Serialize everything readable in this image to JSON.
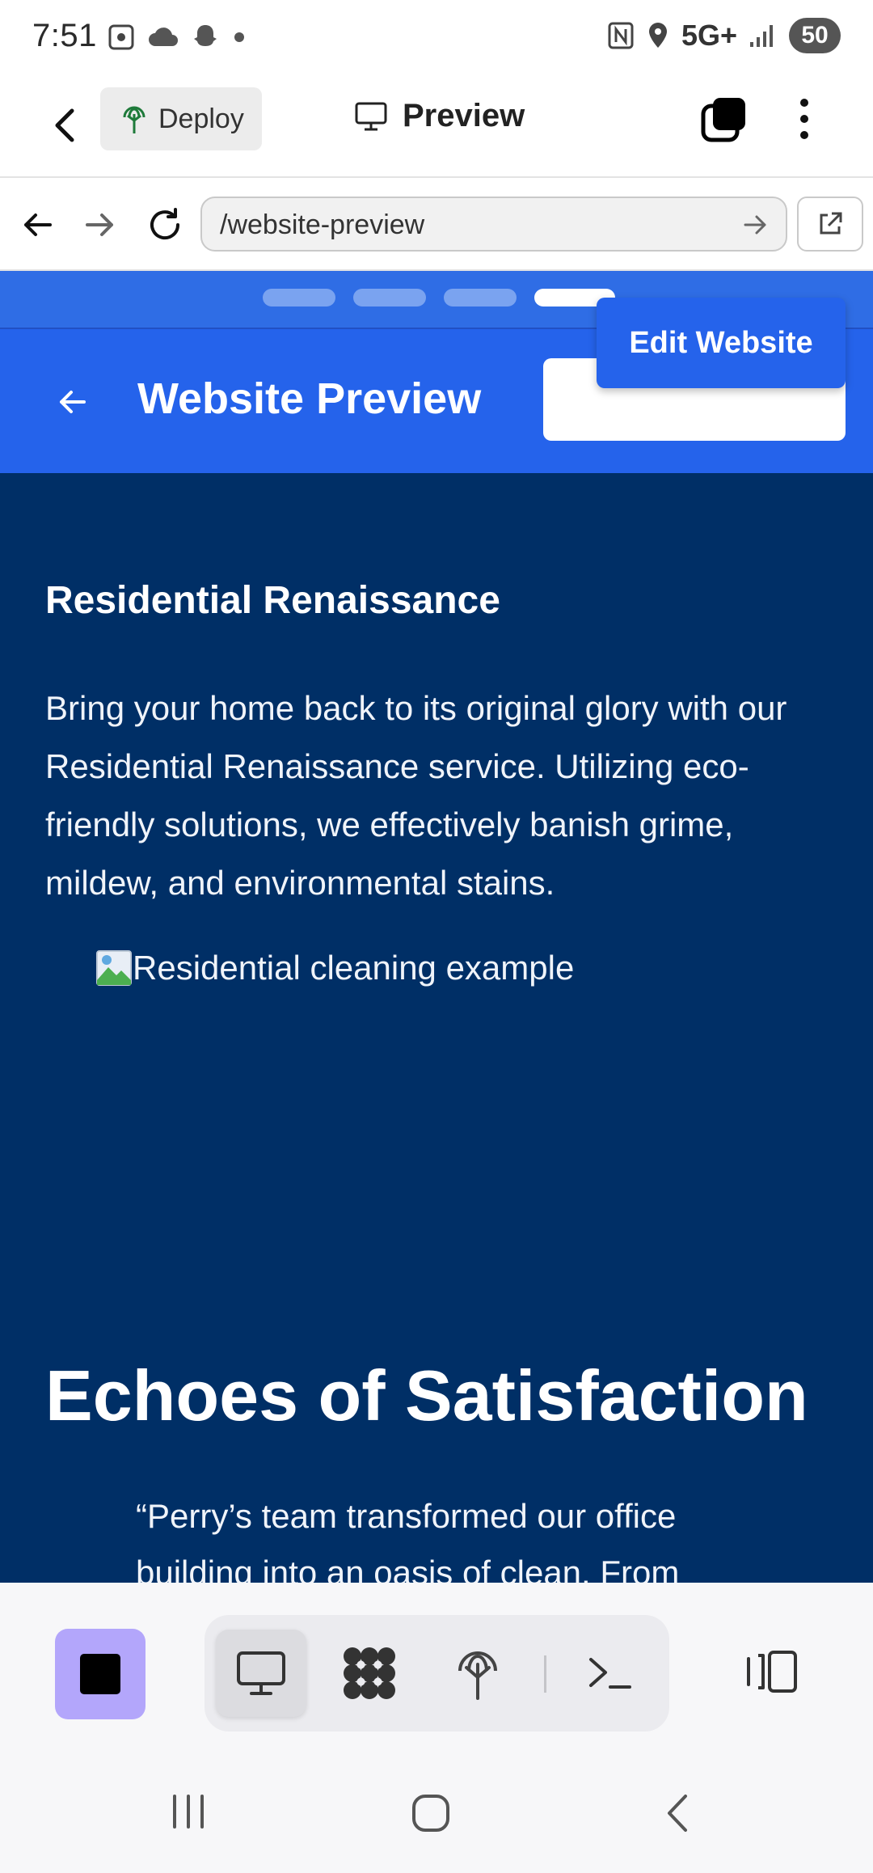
{
  "status_bar": {
    "time": "7:51",
    "network": "5G+",
    "battery": "50"
  },
  "app_header": {
    "deploy_label": "Deploy",
    "preview_label": "Preview"
  },
  "browser": {
    "url": "/website-preview"
  },
  "site": {
    "header_title": "Website Preview",
    "edit_button": "Edit Website",
    "page_dots_count": 4,
    "active_dot": 4
  },
  "content": {
    "service_title": "Residential Renaissance",
    "service_description": "Bring your home back to its original glory with our Residential Renaissance service. Utilizing eco-friendly solutions, we effectively banish grime, mildew, and environmental stains.",
    "image_alt": "Residential cleaning example",
    "section_title": "Echoes of Satisfaction",
    "quote_start": "“Perry’s team transformed our office building into an oasis of clean. From"
  },
  "colors": {
    "site_blue": "#2563eb",
    "content_navy": "#002f66",
    "stop_button": "#b3a6fb"
  }
}
